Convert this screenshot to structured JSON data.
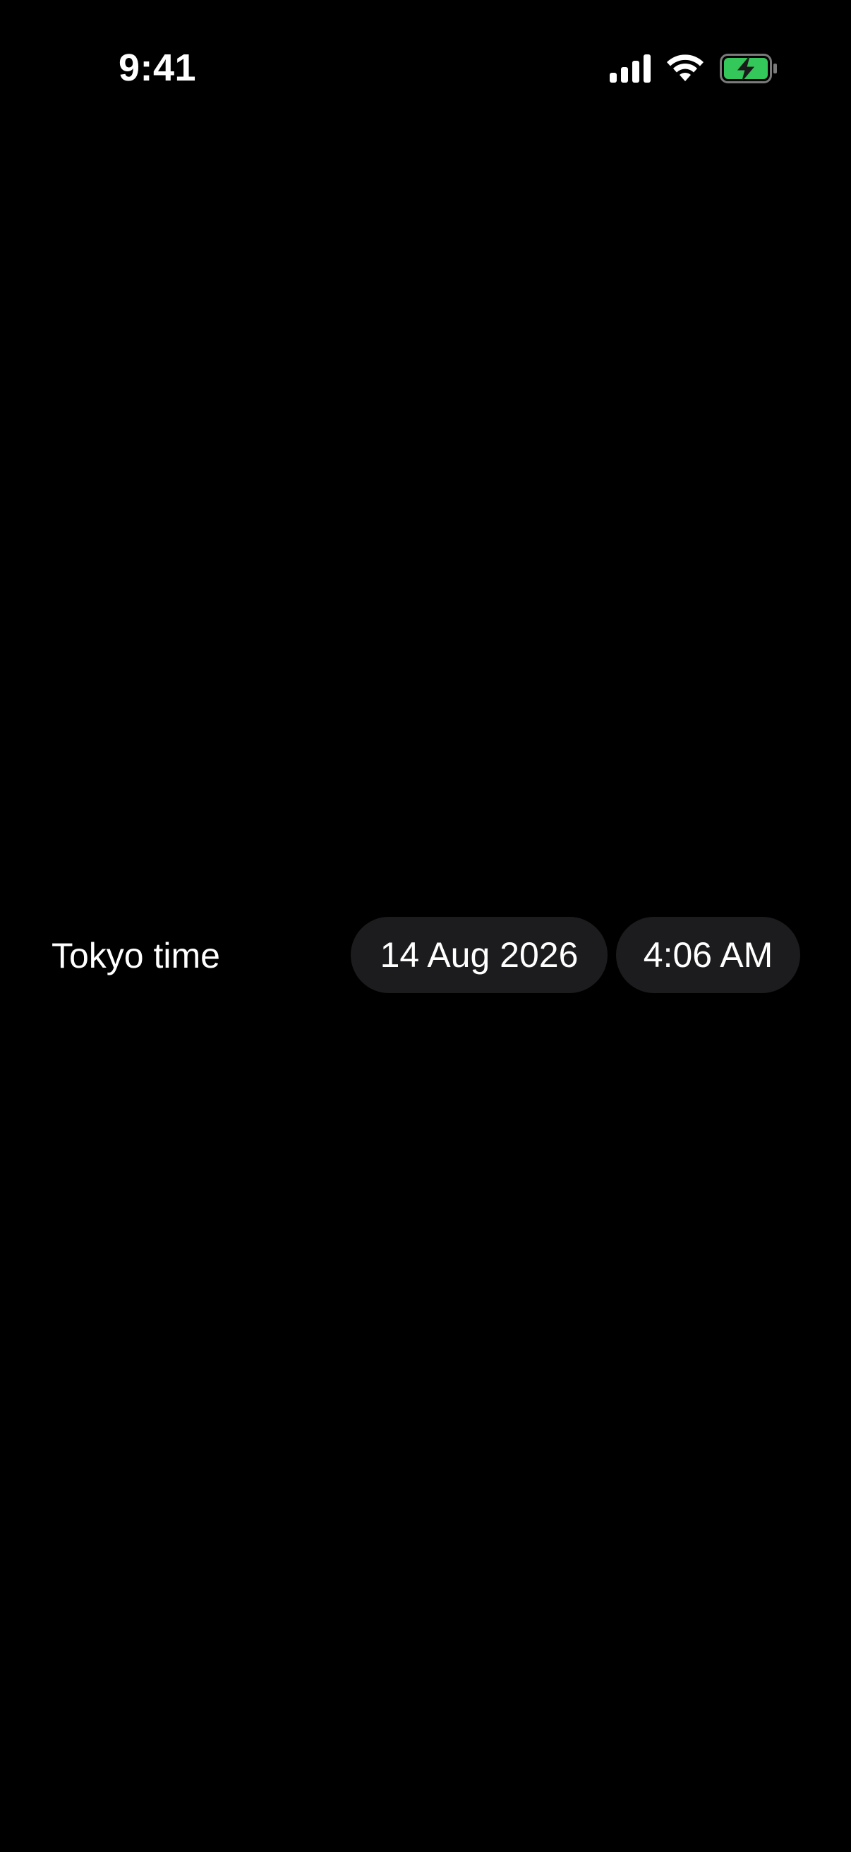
{
  "status_bar": {
    "time": "9:41",
    "icons": [
      "cellular-signal-icon",
      "wifi-icon",
      "battery-charging-icon"
    ],
    "battery_color": "#34c759"
  },
  "clock": {
    "label": "Tokyo time",
    "date": "14 Aug 2026",
    "time": "4:06 AM"
  },
  "colors": {
    "background": "#000000",
    "pill_background": "#1c1c1e",
    "text": "#ffffff"
  }
}
